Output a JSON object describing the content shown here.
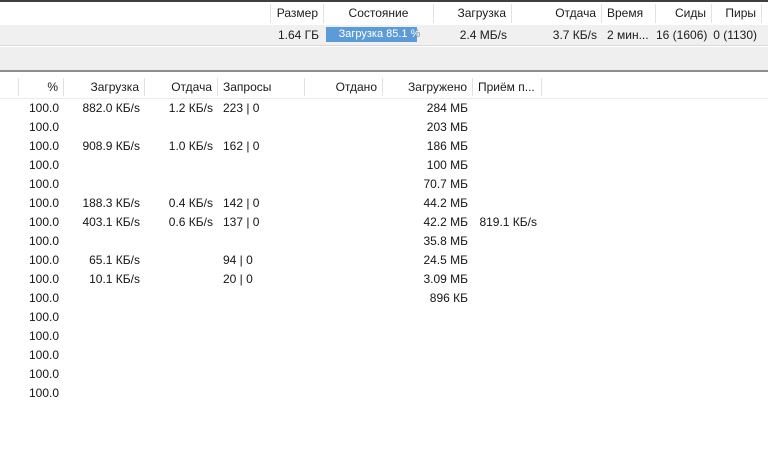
{
  "colors": {
    "progress_fill": "#5b9cd8",
    "progress_text_on_fill": "#ffffff",
    "progress_text_off_fill": "#8f9398",
    "torrent_row_bg": "#f0f0f1"
  },
  "torrent_list": {
    "columns": [
      {
        "label": "Размер"
      },
      {
        "label": "Состояние"
      },
      {
        "label": "Загрузка"
      },
      {
        "label": "Отдача"
      },
      {
        "label": "Время"
      },
      {
        "label": "Сиды"
      },
      {
        "label": "Пиры"
      }
    ],
    "row": {
      "size": "1.64 ГБ",
      "status_label": "Загрузка 85.1 %",
      "progress_percent": 85.1,
      "download_speed": "2.4 МБ/s",
      "upload_speed": "3.7 КБ/s",
      "eta": "2 мин...",
      "seeds": "16 (1606)",
      "peers": "0 (1130)"
    }
  },
  "peer_table": {
    "columns": [
      "%",
      "Загрузка",
      "Отдача",
      "Запросы",
      "Отдано",
      "Загружено",
      "Приём п..."
    ],
    "rows": [
      [
        "100.0",
        "882.0 КБ/s",
        "1.2 КБ/s",
        "223 | 0",
        "",
        "284 МБ",
        ""
      ],
      [
        "100.0",
        "",
        "",
        "",
        "",
        "203 МБ",
        ""
      ],
      [
        "100.0",
        "908.9 КБ/s",
        "1.0 КБ/s",
        "162 | 0",
        "",
        "186 МБ",
        ""
      ],
      [
        "100.0",
        "",
        "",
        "",
        "",
        "100 МБ",
        ""
      ],
      [
        "100.0",
        "",
        "",
        "",
        "",
        "70.7 МБ",
        ""
      ],
      [
        "100.0",
        "188.3 КБ/s",
        "0.4 КБ/s",
        "142 | 0",
        "",
        "44.2 МБ",
        ""
      ],
      [
        "100.0",
        "403.1 КБ/s",
        "0.6 КБ/s",
        "137 | 0",
        "",
        "42.2 МБ",
        "819.1 КБ/s"
      ],
      [
        "100.0",
        "",
        "",
        "",
        "",
        "35.8 МБ",
        ""
      ],
      [
        "100.0",
        "65.1 КБ/s",
        "",
        "94 | 0",
        "",
        "24.5 МБ",
        ""
      ],
      [
        "100.0",
        "10.1 КБ/s",
        "",
        "20 | 0",
        "",
        "3.09 МБ",
        ""
      ],
      [
        "100.0",
        "",
        "",
        "",
        "",
        "896 КБ",
        ""
      ],
      [
        "100.0",
        "",
        "",
        "",
        "",
        "",
        ""
      ],
      [
        "100.0",
        "",
        "",
        "",
        "",
        "",
        ""
      ],
      [
        "100.0",
        "",
        "",
        "",
        "",
        "",
        ""
      ],
      [
        "100.0",
        "",
        "",
        "",
        "",
        "",
        ""
      ],
      [
        "100.0",
        "",
        "",
        "",
        "",
        "",
        ""
      ]
    ]
  }
}
